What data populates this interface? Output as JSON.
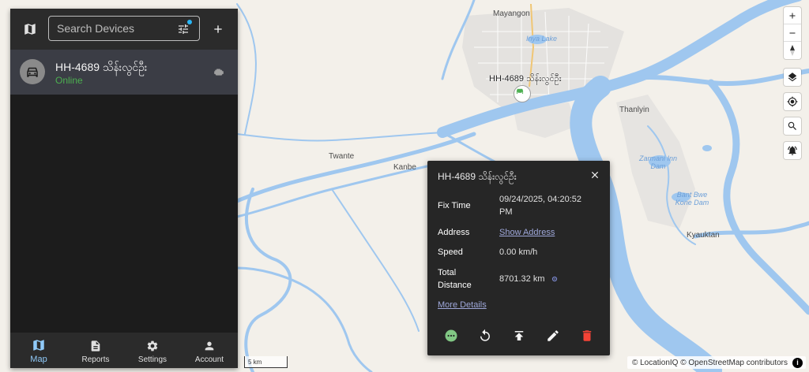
{
  "map": {
    "place_labels": [
      {
        "text": "Mayangon"
      },
      {
        "text": "Thanlyin"
      },
      {
        "text": "Twante"
      },
      {
        "text": "Kanbe"
      },
      {
        "text": "Kyauktan"
      }
    ],
    "water_labels": [
      {
        "text": "Inya Lake"
      },
      {
        "text": "Zarmani Inn Dam"
      },
      {
        "text": "Bant Bwe Kone Dam"
      }
    ],
    "vehicle_label": "HH-4689 သိန်းလွင်ဦး",
    "scale_label": "5 km",
    "attribution": "© LocationIQ © OpenStreetMap contributors",
    "attribution_info": "i"
  },
  "sidebar": {
    "search": {
      "placeholder": "Search Devices",
      "value": ""
    },
    "devices": [
      {
        "name": "HH-4689 သိန်းလွင်ဦး",
        "status": "Online",
        "icon": "car-icon"
      }
    ],
    "nav": [
      {
        "label": "Map",
        "icon": "map-icon",
        "active": true
      },
      {
        "label": "Reports",
        "icon": "description-icon"
      },
      {
        "label": "Settings",
        "icon": "gear-icon"
      },
      {
        "label": "Account",
        "icon": "person-icon"
      }
    ]
  },
  "popup": {
    "title": "HH-4689 သိန်းလွင်ဦး",
    "rows": {
      "fix_time": {
        "label": "Fix Time",
        "value_line1": "09/24/2025, 04:20:52",
        "value_line2": "PM"
      },
      "address": {
        "label": "Address",
        "value": "Show Address"
      },
      "speed": {
        "label": "Speed",
        "value": "0.00 km/h"
      },
      "total_distance": {
        "label_line1": "Total",
        "label_line2": "Distance",
        "value": "8701.32 km"
      }
    },
    "more_details": "More Details"
  },
  "colors": {
    "accent_blue": "#90caf9",
    "online_green": "#4caf50",
    "delete_red": "#f44336",
    "water": "#9fc7ef",
    "land": "#f3f0ea"
  }
}
